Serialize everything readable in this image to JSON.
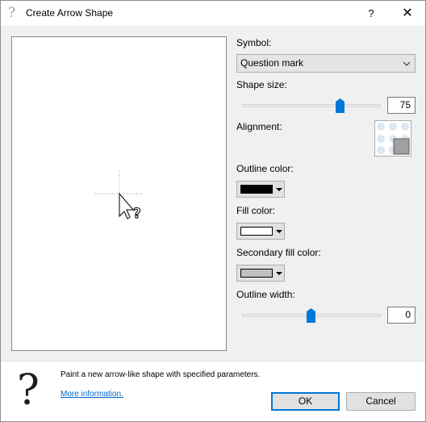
{
  "window": {
    "title": "Create Arrow Shape",
    "help_label": "?",
    "close_label": "✕"
  },
  "symbol": {
    "label": "Symbol:",
    "selected": "Question mark"
  },
  "shape_size": {
    "label": "Shape size:",
    "value": "75"
  },
  "alignment": {
    "label": "Alignment:",
    "selected": "bottom-right"
  },
  "outline_color": {
    "label": "Outline color:",
    "color": "#000000"
  },
  "fill_color": {
    "label": "Fill color:",
    "color": "#ffffff"
  },
  "secondary_fill_color": {
    "label": "Secondary fill color:",
    "color": "#c0c0c0"
  },
  "outline_width": {
    "label": "Outline width:",
    "value": "0"
  },
  "footer": {
    "description": "Paint a new arrow-like shape with specified parameters.",
    "link": "More information.",
    "ok_label": "OK",
    "cancel_label": "Cancel"
  },
  "icons": {
    "title": "question-icon",
    "footer": "question-icon",
    "dropdown": "chevron-down-icon",
    "preview": "question-cursor-icon"
  },
  "accent_color": "#0078d7"
}
